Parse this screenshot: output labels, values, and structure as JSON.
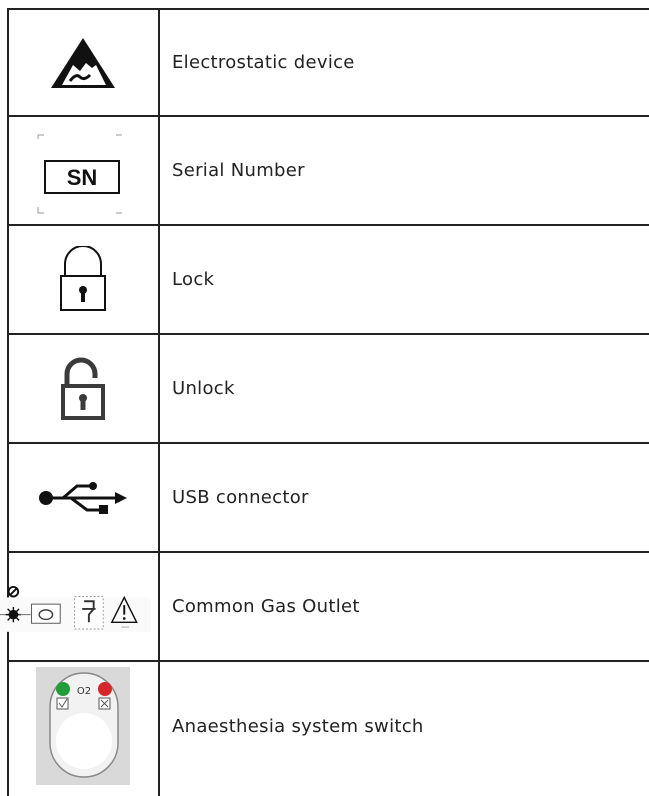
{
  "rows": [
    {
      "icon": "electrostatic-device-icon",
      "label": "Electrostatic device"
    },
    {
      "icon": "serial-number-icon",
      "label": "Serial Number",
      "icon_text": "SN"
    },
    {
      "icon": "lock-icon",
      "label": "Lock"
    },
    {
      "icon": "unlock-icon",
      "label": "Unlock"
    },
    {
      "icon": "usb-connector-icon",
      "label": "USB connector"
    },
    {
      "icon": "common-gas-outlet-icon",
      "label": "Common Gas Outlet"
    },
    {
      "icon": "anaesthesia-switch-icon",
      "label": "Anaesthesia system switch",
      "icon_text": "O2"
    }
  ]
}
